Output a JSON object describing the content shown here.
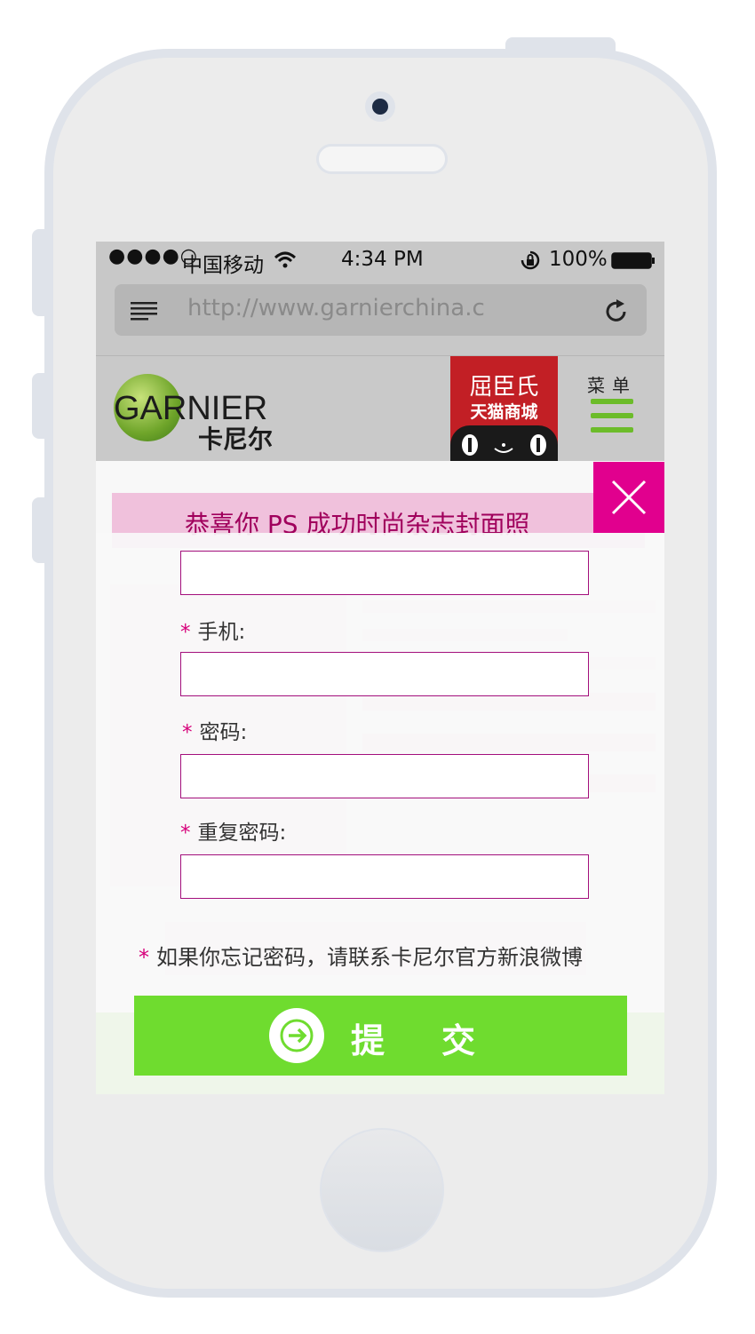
{
  "status": {
    "signal": "●●●●○",
    "carrier": "中国移动",
    "time": "4:34 PM",
    "battery": "100%"
  },
  "browser": {
    "url": "http://www.garnierchina.c"
  },
  "header": {
    "logo_text": "GARNIER",
    "logo_cn": "卡尼尔",
    "tmall_line1": "屈臣氏",
    "tmall_line2": "天猫商城",
    "menu_label": "菜单"
  },
  "background": {
    "banner_title": "恭喜你 PS 成功时尚杂志封面照"
  },
  "form": {
    "phone_label": "手机:",
    "password_label": "密码:",
    "repeat_password_label": "重复密码:",
    "required_mark": "*",
    "note": "如果你忘记密码，请联系卡尼尔官方新浪微博",
    "submit_label": "提交"
  },
  "colors": {
    "accent_magenta": "#e1008e",
    "submit_green": "#6fdc2f",
    "menu_green": "#6cbc2a",
    "tmall_red": "#c21f25"
  }
}
